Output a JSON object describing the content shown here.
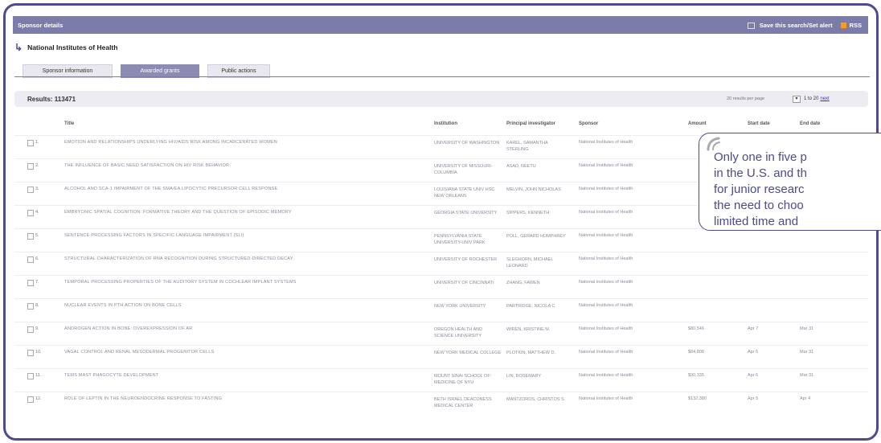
{
  "header": {
    "title": "Sponsor details",
    "save_search": "Save this search/Set alert",
    "rss": "RSS"
  },
  "sponsor": {
    "name": "National Institutes of Health"
  },
  "tabs": [
    {
      "label": "Sponsor information",
      "active": false
    },
    {
      "label": "Awarded grants",
      "active": true
    },
    {
      "label": "Public actions",
      "active": false
    }
  ],
  "results": {
    "label": "Results: 113471",
    "per_page": "20 results per page",
    "range": "1 to 20",
    "next": "next"
  },
  "columns": {
    "title": "Title",
    "institution": "Institution",
    "pi": "Principal investigator",
    "sponsor": "Sponsor",
    "amount": "Amount",
    "start": "Start date",
    "end": "End date"
  },
  "rows": [
    {
      "num": "1.",
      "title": "EMOTION AND RELATIONSHIPS UNDERLYING HIV/AIDS RISK AMONG INCARCERATED WOMEN",
      "institution": "UNIVERSITY OF WASHINGTON",
      "pi": "KAREL, SAMANTHA STERLING",
      "sponsor": "National Institutes of Health",
      "amount": "",
      "start": "",
      "end": ""
    },
    {
      "num": "2.",
      "title": "THE INFLUENCE OF BASIC NEED SATISFACTION ON HIV RISK BEHAVIOR",
      "institution": "UNIVERSITY OF MISSOURI-COLUMBIA",
      "pi": "ASAD, NEETU",
      "sponsor": "National Institutes of Health",
      "amount": "",
      "start": "",
      "end": ""
    },
    {
      "num": "3.",
      "title": "ALCOHOL AND SCA-1 IMPAIRMENT OF THE SMA/EA LIPOCYTIC PRECURSOR CELL RESPONSE",
      "institution": "LOUISIANA STATE UNIV HSC NEW ORLEANS",
      "pi": "MELVIN, JOHN NICHOLAS",
      "sponsor": "National Institutes of Health",
      "amount": "",
      "start": "",
      "end": ""
    },
    {
      "num": "4.",
      "title": "EMBRYONIC SPATIAL COGNITION: FORMATIVE THEORY AND THE QUESTION OF EPISODIC MEMORY",
      "institution": "GEORGIA STATE UNIVERSITY",
      "pi": "SIPPERS, KENNETH",
      "sponsor": "National Institutes of Health",
      "amount": "",
      "start": "",
      "end": ""
    },
    {
      "num": "5.",
      "title": "SENTENCE PROCESSING FACTORS IN SPECIFIC LANGUAGE IMPAIRMENT (SLI)",
      "institution": "PENNSYLVANIA STATE UNIVERSITY-UNIV PARK",
      "pi": "POLL, GERARD HUMPHREY",
      "sponsor": "National Institutes of Health",
      "amount": "",
      "start": "",
      "end": ""
    },
    {
      "num": "6.",
      "title": "STRUCTURAL CHARACTERIZATION OF RNA RECOGNITION DURING STRUCTURED-DIRECTED DECAY",
      "institution": "UNIVERSITY OF ROCHESTER",
      "pi": "SLEGHORN, MICHAEL LEONARD",
      "sponsor": "National Institutes of Health",
      "amount": "",
      "start": "",
      "end": ""
    },
    {
      "num": "7.",
      "title": "TEMPORAL PROCESSING PROPERTIES OF THE AUDITORY SYSTEM IN COCHLEAR IMPLANT SYSTEMS",
      "institution": "UNIVERSITY OF CINCINNATI",
      "pi": "ZHANG, FAWEN",
      "sponsor": "National Institutes of Health",
      "amount": "",
      "start": "",
      "end": ""
    },
    {
      "num": "8.",
      "title": "NUCLEAR EVENTS IN PTH ACTION ON BONE CELLS",
      "institution": "NEW YORK UNIVERSITY",
      "pi": "PARTRIDGE, NICOLA C.",
      "sponsor": "National Institutes of Health",
      "amount": "",
      "start": "",
      "end": ""
    },
    {
      "num": "9.",
      "title": "ANDROGEN ACTION IN BONE: OVEREXPRESSION OF AR",
      "institution": "OREGON HEALTH AND SCIENCE UNIVERSITY",
      "pi": "WIREN, KRISTINE M.",
      "sponsor": "National Institutes of Health",
      "amount": "$80,546",
      "start": "Apr 7",
      "end": "Mar 31"
    },
    {
      "num": "10.",
      "title": "VAGAL CONTROL AND RENAL MESODERMAL PROGENITOR CELLS",
      "institution": "NEW YORK MEDICAL COLLEGE",
      "pi": "PLOTKIN, MATTHEW D.",
      "sponsor": "National Institutes of Health",
      "amount": "$84,808",
      "start": "Apr 6",
      "end": "Mar 31"
    },
    {
      "num": "11.",
      "title": "TEMS MAST PHAGOCYTE DEVELOPMENT",
      "institution": "MOUNT SINAI SCHOOL OF MEDICINE OF NYU",
      "pi": "LIN, ROSEMARY",
      "sponsor": "National Institutes of Health",
      "amount": "$90,335",
      "start": "Apr 6",
      "end": "Mar 31"
    },
    {
      "num": "12.",
      "title": "ROLE OF LEPTIN IN THE NEUROENDOCRINE RESPONSE TO FASTING",
      "institution": "BETH ISRAEL DEACONESS MEDICAL CENTER",
      "pi": "MANTZOROS, CHRISTOS S.",
      "sponsor": "National Institutes of Health",
      "amount": "$132,380",
      "start": "Apr 5",
      "end": "Apr 4"
    }
  ],
  "callout": {
    "lines": [
      "Only one in five p",
      "in the U.S. and th",
      "for junior researc",
      "the need to choo",
      "limited time and"
    ]
  },
  "colors": {
    "accent": "#4d4b8c",
    "header_bar": "#7c7ca9",
    "active_tab": "#8b8bb4",
    "rss": "#f39c32"
  }
}
